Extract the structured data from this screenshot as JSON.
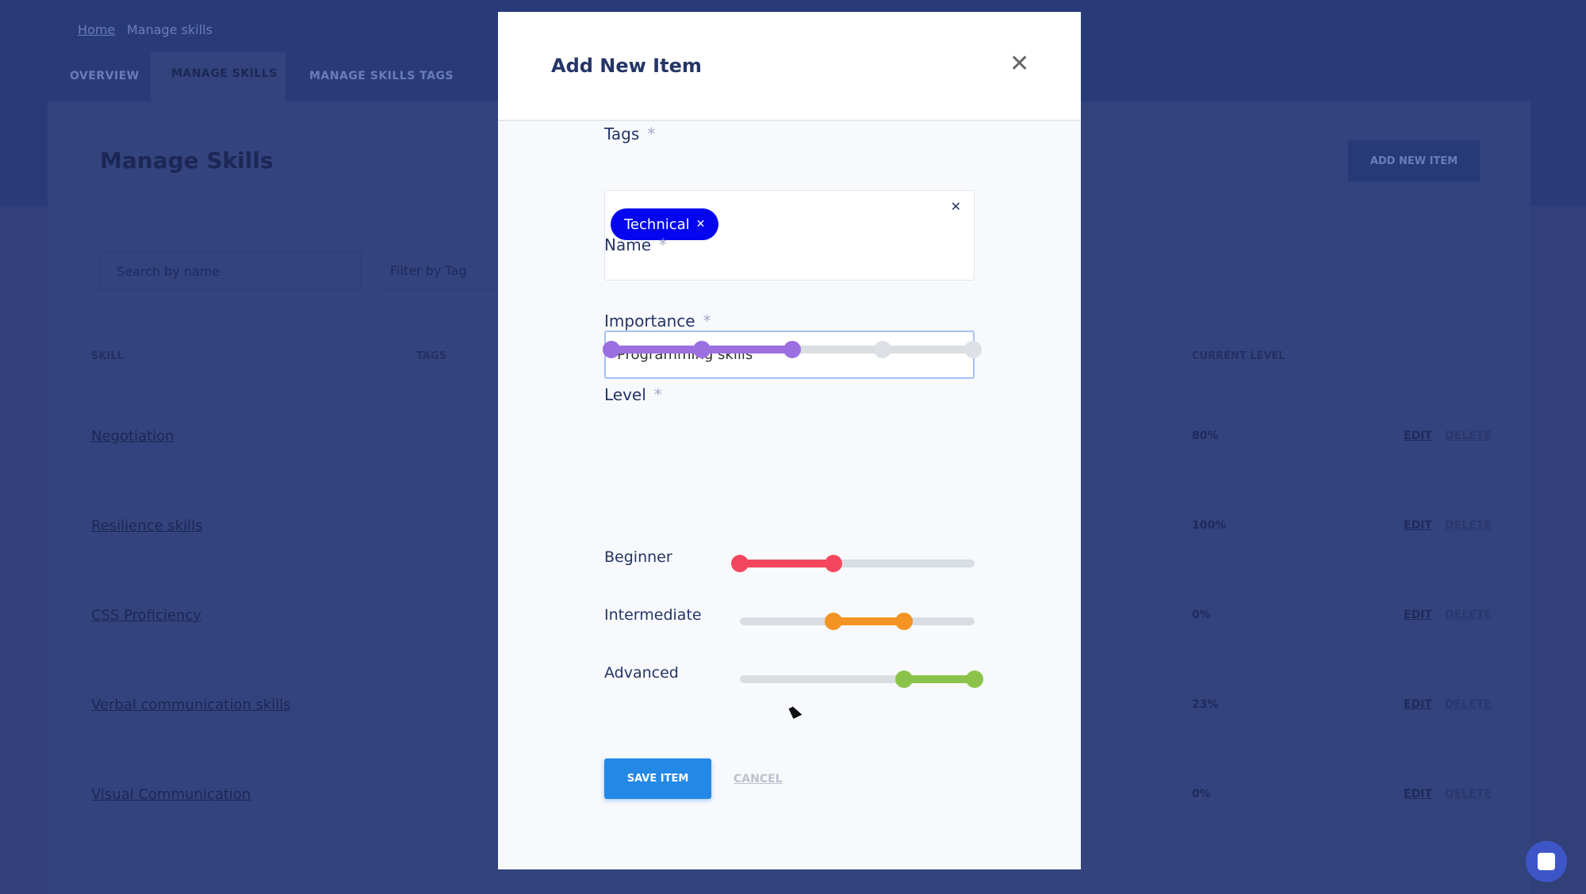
{
  "background": {
    "breadcrumb": [
      "Home",
      "Manage skills"
    ],
    "tabs": [
      "OVERVIEW",
      "MANAGE SKILLS",
      "MANAGE SKILLS TAGS"
    ],
    "page_title": "Manage Skills",
    "add_button": "ADD NEW ITEM",
    "search_placeholder": "Search by name",
    "filter_placeholder": "Filter by Tag",
    "columns": [
      "SKILL",
      "TAGS",
      "CURRENT LEVEL"
    ],
    "rows": [
      {
        "name": "Negotiation",
        "level": "80%"
      },
      {
        "name": "Resilience skills",
        "level": "100%"
      },
      {
        "name": "CSS Proficiency",
        "level": "0%"
      },
      {
        "name": "Verbal communication skills",
        "level": "23%"
      },
      {
        "name": "Visual Communication",
        "level": "0%"
      }
    ],
    "edit_label": "EDIT",
    "delete_label": "DELETE"
  },
  "modal": {
    "title": "Add New Item",
    "close_icon": "close-icon",
    "tags": {
      "label": "Tags",
      "required": "*",
      "chips": [
        "Technical"
      ],
      "chip_color": "#0505f0"
    },
    "name": {
      "label": "Name",
      "required": "*",
      "value": "Programming skills"
    },
    "importance": {
      "label": "Importance",
      "required": "*",
      "value": 3,
      "max": 5,
      "color": "#9b6fe0"
    },
    "level": {
      "label": "Level",
      "required": "*",
      "ranges": [
        {
          "label": "Beginner",
          "from": 0,
          "to": 40,
          "color": "#f4475f"
        },
        {
          "label": "Intermediate",
          "from": 40,
          "to": 70,
          "color": "#f39322"
        },
        {
          "label": "Advanced",
          "from": 70,
          "to": 100,
          "color": "#8bc34a"
        }
      ]
    },
    "save_label": "SAVE ITEM",
    "cancel_label": "CANCEL"
  }
}
